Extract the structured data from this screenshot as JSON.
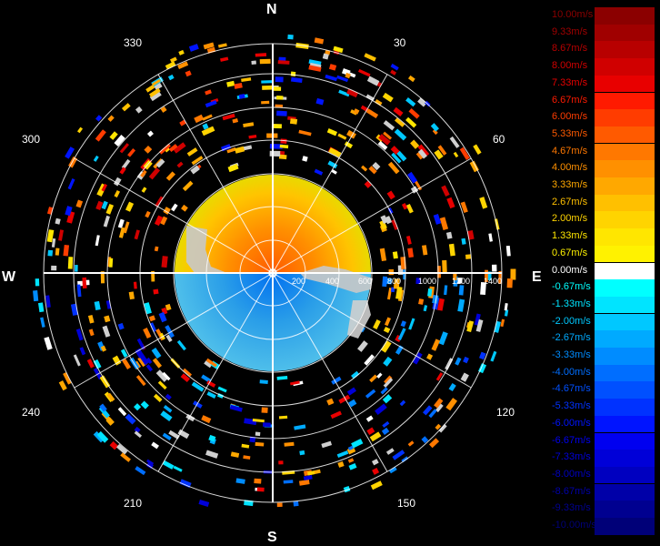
{
  "compass": {
    "north": "N",
    "east": "E",
    "south": "S",
    "west": "W"
  },
  "azimuth_labels": [
    "30",
    "60",
    "120",
    "150",
    "210",
    "240",
    "300",
    "330"
  ],
  "range_labels": [
    "200",
    "400",
    "600",
    "800",
    "1000",
    "1200",
    "1400"
  ],
  "legend": [
    {
      "label": "10.00m/s",
      "color": "#8b0000"
    },
    {
      "label": "9.33m/s",
      "color": "#a00000"
    },
    {
      "label": "8.67m/s",
      "color": "#b80000"
    },
    {
      "label": "8.00m/s",
      "color": "#d00000"
    },
    {
      "label": "7.33m/s",
      "color": "#e80000"
    },
    {
      "label": "6.67m/s",
      "color": "#ff1a00"
    },
    {
      "label": "6.00m/s",
      "color": "#ff3c00"
    },
    {
      "label": "5.33m/s",
      "color": "#ff5a00"
    },
    {
      "label": "4.67m/s",
      "color": "#ff7800"
    },
    {
      "label": "4.00m/s",
      "color": "#ff9000"
    },
    {
      "label": "3.33m/s",
      "color": "#ffa800"
    },
    {
      "label": "2.67m/s",
      "color": "#ffc000"
    },
    {
      "label": "2.00m/s",
      "color": "#ffd400"
    },
    {
      "label": "1.33m/s",
      "color": "#ffe600"
    },
    {
      "label": "0.67m/s",
      "color": "#fff200"
    },
    {
      "label": "0.00m/s",
      "color": "#ffffff"
    },
    {
      "label": "-0.67m/s",
      "color": "#00ffff"
    },
    {
      "label": "-1.33m/s",
      "color": "#00e4ff"
    },
    {
      "label": "-2.00m/s",
      "color": "#00c8ff"
    },
    {
      "label": "-2.67m/s",
      "color": "#00aaff"
    },
    {
      "label": "-3.33m/s",
      "color": "#008cff"
    },
    {
      "label": "-4.00m/s",
      "color": "#006eff"
    },
    {
      "label": "-4.67m/s",
      "color": "#0050ff"
    },
    {
      "label": "-5.33m/s",
      "color": "#0032ff"
    },
    {
      "label": "-6.00m/s",
      "color": "#0014ff"
    },
    {
      "label": "-6.67m/s",
      "color": "#0000f0"
    },
    {
      "label": "-7.33m/s",
      "color": "#0000d8"
    },
    {
      "label": "-8.00m/s",
      "color": "#0000c0"
    },
    {
      "label": "-8.67m/s",
      "color": "#0000a8"
    },
    {
      "label": "-9.33m/s",
      "color": "#000090"
    },
    {
      "label": "-10.00m/s",
      "color": "#000078"
    }
  ]
}
